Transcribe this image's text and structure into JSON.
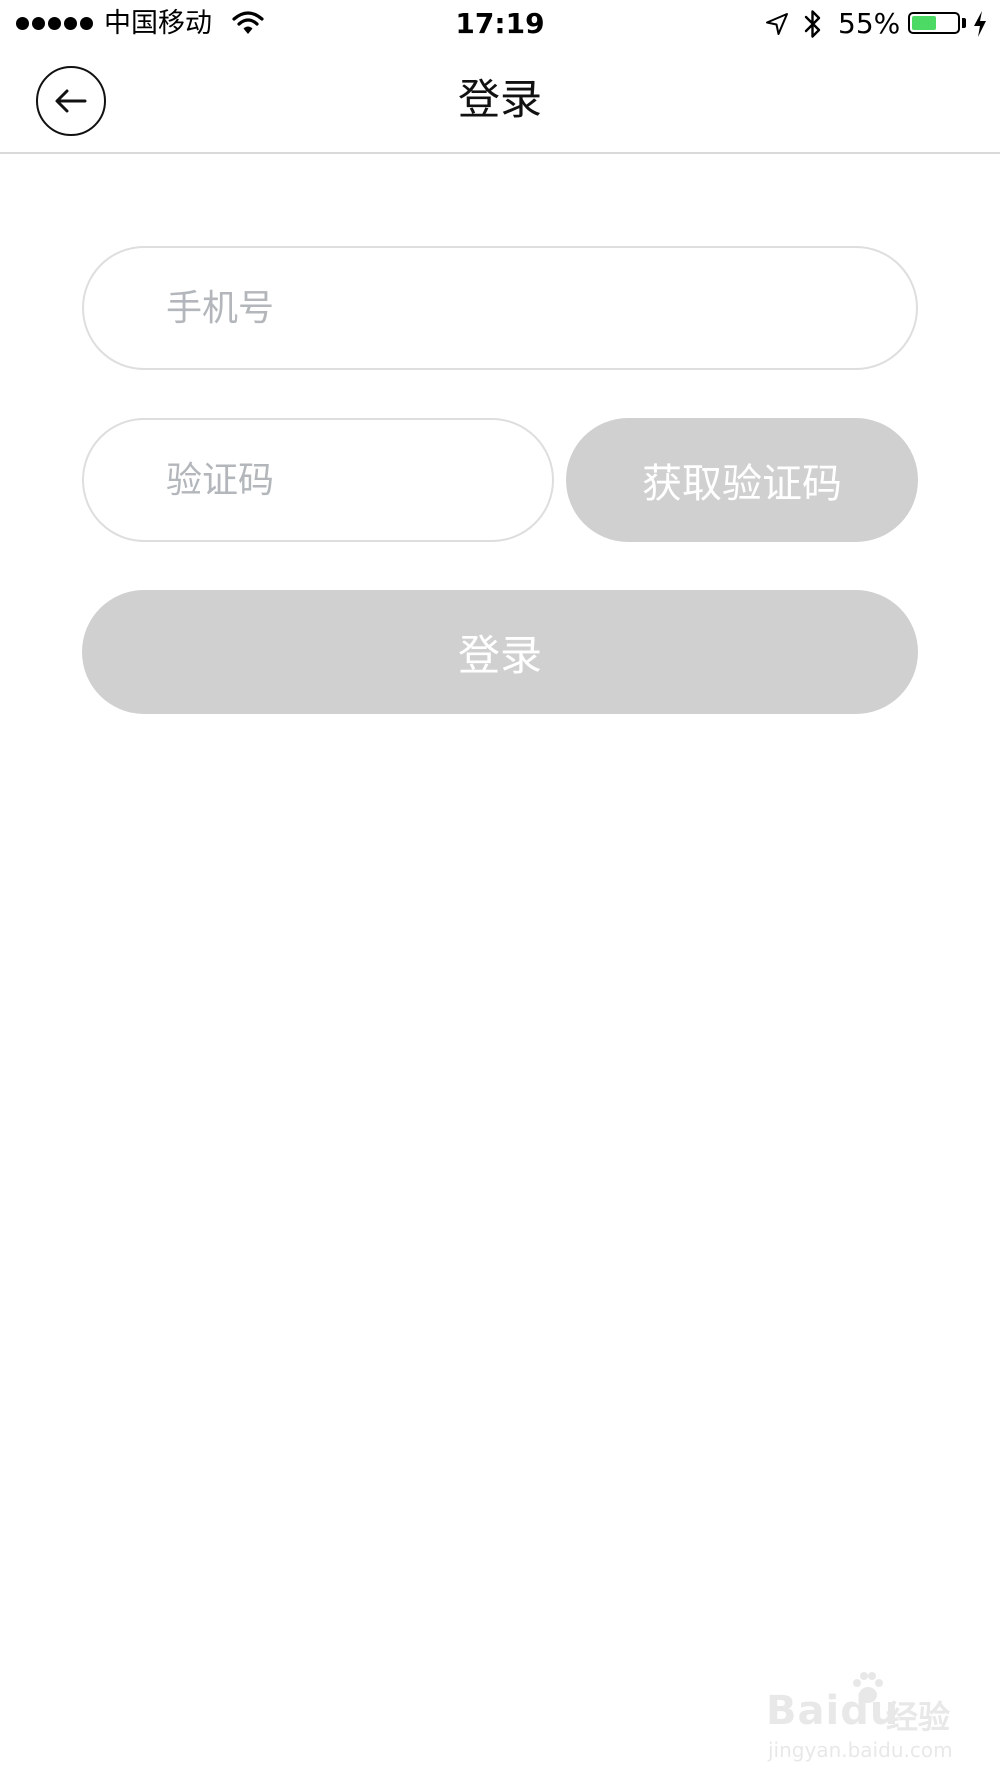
{
  "status_bar": {
    "carrier": "中国移动",
    "time": "17:19",
    "battery_percent_text": "55%",
    "battery_level": 0.55,
    "signal_bars": 5,
    "battery_color": "#4cd964"
  },
  "nav": {
    "title": "登录",
    "back_icon": "arrow-left-icon"
  },
  "form": {
    "phone_placeholder": "手机号",
    "phone_value": "",
    "code_placeholder": "验证码",
    "code_value": "",
    "get_code_label": "获取验证码",
    "login_label": "登录",
    "disabled_button_color": "#d0d0d0"
  },
  "watermark": {
    "brand": "Baidu",
    "brand_cn": "经验",
    "url": "jingyan.baidu.com"
  }
}
